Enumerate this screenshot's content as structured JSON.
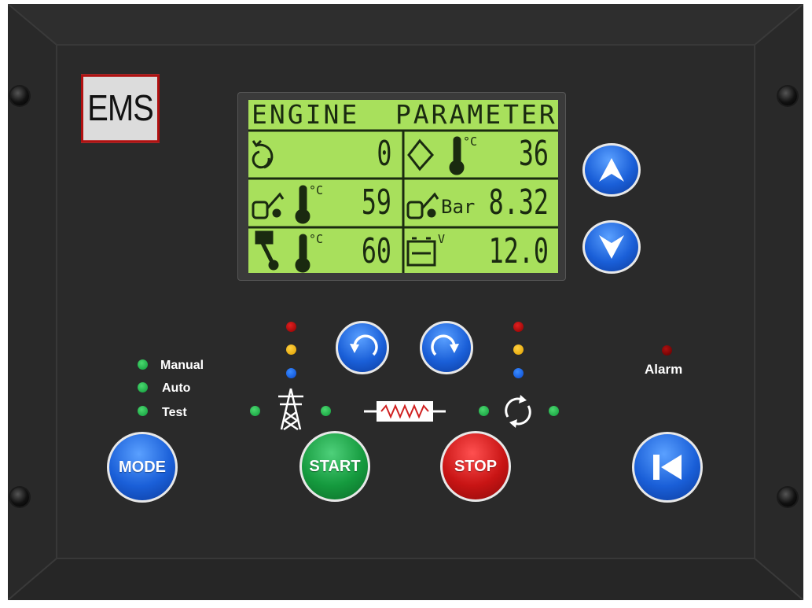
{
  "brand": {
    "logo_text": "EMS"
  },
  "lcd": {
    "title": "ENGINE  PARAMETERS",
    "cells": [
      {
        "icon": "engine-speed-icon",
        "value": "0",
        "unit": ""
      },
      {
        "icon": "coolant-temperature-icon",
        "value": "36",
        "unit": "°C"
      },
      {
        "icon": "oil-temperature-icon",
        "value": "59",
        "unit": "°C"
      },
      {
        "icon": "oil-pressure-icon",
        "value": "8.32",
        "unit": "Bar"
      },
      {
        "icon": "exhaust-temperature-icon",
        "value": "60",
        "unit": "°C"
      },
      {
        "icon": "battery-voltage-icon",
        "value": "12.0",
        "unit": "V"
      }
    ],
    "background_color": "#a8e05c"
  },
  "mode_indicators": [
    {
      "label": "Manual",
      "color": "#1fb84a"
    },
    {
      "label": "Auto",
      "color": "#1fb84a"
    },
    {
      "label": "Test",
      "color": "#1fb84a"
    }
  ],
  "alarm": {
    "label": "Alarm",
    "color": "#b01010"
  },
  "buttons": {
    "mode": "MODE",
    "start": "START",
    "stop": "STOP"
  },
  "colors": {
    "panel": "#2a2a2a",
    "bezel": "#333333",
    "button_blue": "#1a5fd8",
    "button_green": "#159a3e",
    "button_red": "#c81414"
  }
}
